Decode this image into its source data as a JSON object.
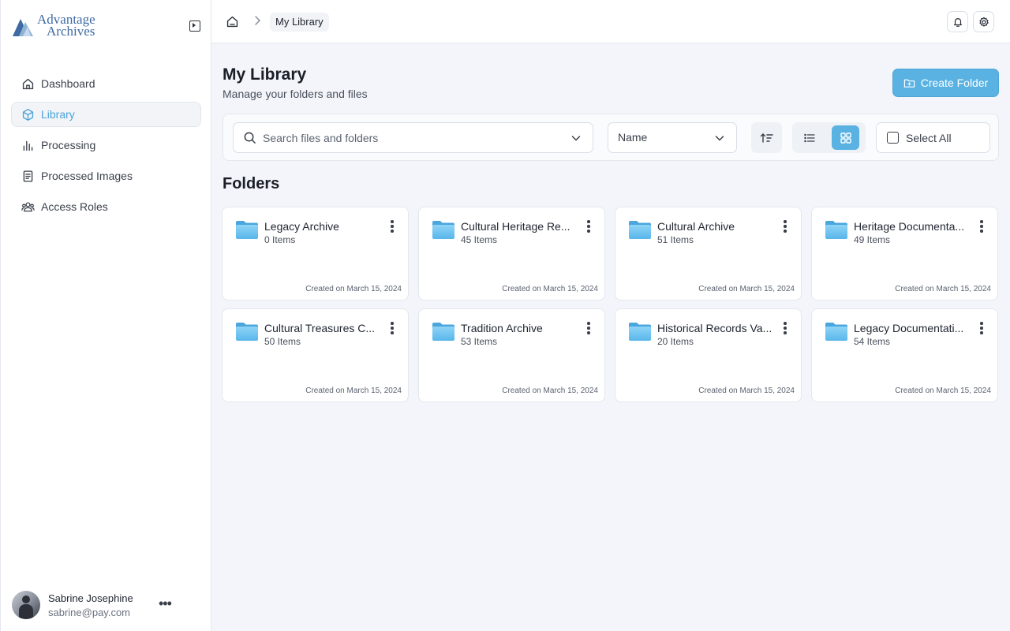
{
  "brand": {
    "line1": "Advantage",
    "line2": "Archives"
  },
  "sidebar": {
    "items": [
      {
        "label": "Dashboard",
        "icon": "home-icon",
        "active": false
      },
      {
        "label": "Library",
        "icon": "cube-icon",
        "active": true
      },
      {
        "label": "Processing",
        "icon": "bar-chart-icon",
        "active": false
      },
      {
        "label": "Processed Images",
        "icon": "document-icon",
        "active": false
      },
      {
        "label": "Access Roles",
        "icon": "users-icon",
        "active": false
      }
    ]
  },
  "user": {
    "name": "Sabrine Josephine",
    "email": "sabrine@pay.com"
  },
  "breadcrumb": {
    "current": "My Library"
  },
  "page": {
    "title": "My Library",
    "subtitle": "Manage your folders and files"
  },
  "actions": {
    "create_folder": "Create Folder"
  },
  "toolbar": {
    "search_placeholder": "Search files and folders",
    "sort_value": "Name",
    "select_all": "Select All",
    "view_mode": "grid"
  },
  "folders_section": {
    "title": "Folders"
  },
  "folders": [
    {
      "name": "Legacy Archive",
      "count": "0 Items",
      "created": "Created on March 15, 2024"
    },
    {
      "name": "Cultural Heritage Re...",
      "count": "45 Items",
      "created": "Created on March 15, 2024"
    },
    {
      "name": "Cultural Archive",
      "count": "51 Items",
      "created": "Created on March 15, 2024"
    },
    {
      "name": "Heritage Documenta...",
      "count": "49 Items",
      "created": "Created on March 15, 2024"
    },
    {
      "name": "Cultural Treasures C...",
      "count": "50 Items",
      "created": "Created on March 15, 2024"
    },
    {
      "name": "Tradition Archive",
      "count": "53 Items",
      "created": "Created on March 15, 2024"
    },
    {
      "name": "Historical Records Va...",
      "count": "20 Items",
      "created": "Created on March 15, 2024"
    },
    {
      "name": "Legacy Documentati...",
      "count": "54 Items",
      "created": "Created on March 15, 2024"
    }
  ],
  "colors": {
    "accent": "#59b2e2",
    "active_nav": "#4ba3d9",
    "brand": "#3f6aa2"
  }
}
